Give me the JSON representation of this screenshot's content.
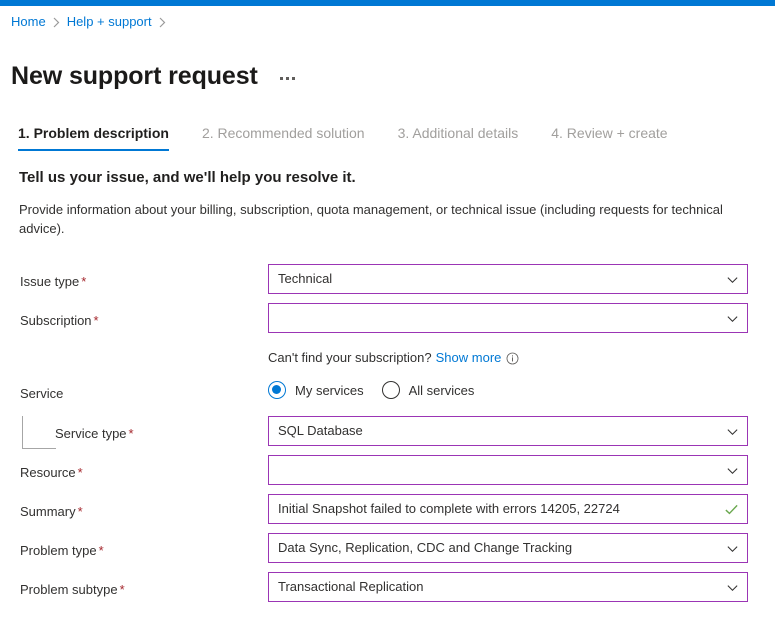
{
  "theme": {
    "accent_blue": "#0078d4",
    "field_border_purple": "#9b35b5",
    "required_red": "#a4262c",
    "valid_green": "#6aa84f",
    "muted_gray": "#a19f9d"
  },
  "breadcrumb": {
    "items": [
      {
        "label": "Home"
      },
      {
        "label": "Help + support"
      }
    ],
    "separator_icon": "chevron-right-icon"
  },
  "header": {
    "title": "New support request",
    "more_menu_icon": "ellipsis-horizontal-icon"
  },
  "wizard": {
    "tabs": [
      {
        "label": "1. Problem description",
        "active": true
      },
      {
        "label": "2. Recommended solution",
        "active": false
      },
      {
        "label": "3. Additional details",
        "active": false
      },
      {
        "label": "4. Review + create",
        "active": false
      }
    ]
  },
  "intro": {
    "heading": "Tell us your issue, and we'll help you resolve it.",
    "body": "Provide information about your billing, subscription, quota management, or technical issue (including requests for technical advice)."
  },
  "form": {
    "issue_type": {
      "label": "Issue type",
      "required_marker": "*",
      "value": "Technical",
      "chevron_icon": "chevron-down-icon"
    },
    "subscription": {
      "label": "Subscription",
      "required_marker": "*",
      "value": "",
      "chevron_icon": "chevron-down-icon"
    },
    "subscription_helper": {
      "text": "Can't find your subscription?",
      "link_label": "Show more",
      "info_icon": "info-circle-icon"
    },
    "service": {
      "label": "Service",
      "options": [
        {
          "label": "My services",
          "selected": true
        },
        {
          "label": "All services",
          "selected": false
        }
      ]
    },
    "service_type": {
      "label": "Service type",
      "required_marker": "*",
      "value": "SQL Database",
      "chevron_icon": "chevron-down-icon"
    },
    "resource": {
      "label": "Resource",
      "required_marker": "*",
      "value": "",
      "chevron_icon": "chevron-down-icon"
    },
    "summary": {
      "label": "Summary",
      "required_marker": "*",
      "value": "Initial Snapshot failed to complete with errors 14205, 22724",
      "validation_icon": "checkmark-icon"
    },
    "problem_type": {
      "label": "Problem type",
      "required_marker": "*",
      "value": "Data Sync, Replication, CDC and Change Tracking",
      "chevron_icon": "chevron-down-icon"
    },
    "problem_subtype": {
      "label": "Problem subtype",
      "required_marker": "*",
      "value": "Transactional Replication",
      "chevron_icon": "chevron-down-icon"
    }
  }
}
